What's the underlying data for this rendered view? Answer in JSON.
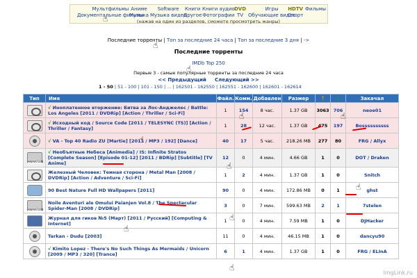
{
  "categories": {
    "col1": [
      "Мультфильмы",
      "Документальные фильмы"
    ],
    "col2": [
      "Аниме",
      "Музыка"
    ],
    "col3": [
      "Software",
      "Музыка видео"
    ],
    "col4": [
      "Книги",
      "Другое"
    ],
    "col5": [
      "Книги аудио",
      "Фотографии"
    ],
    "col6": [
      "DVD",
      "TV"
    ],
    "col7": [
      "Игры",
      "Обучающие видео"
    ],
    "col8": [
      "HDTV",
      "Спорт"
    ],
    "col9": [
      "Фильмы",
      ""
    ],
    "hint": "(нажав на один из разделов, сможете просмотреть жанры)"
  },
  "toplinks": {
    "current": "Последние торренты",
    "link1": "Топ за последние 24 часа",
    "link2": "Топ за последние 3 дня",
    "link3": "->"
  },
  "title": "Последние торренты",
  "imdb": "IMDb Top 250",
  "note": "Первые 3 - самые популярные торренты за последние 24 часа",
  "nav": {
    "prev": "<< Предыдущий",
    "next": "Следующий >>"
  },
  "pages": {
    "current": "1 - 50",
    "items": [
      "51 - 100",
      "101 - 150",
      "...",
      "162501 - 162550",
      "162551 - 162600",
      "162601 - 162614"
    ]
  },
  "table": {
    "headers": [
      "Тип",
      "Имя",
      "Файл.",
      "Комм.",
      "Добавлен",
      "Размер",
      "↑",
      "↓",
      "Закачал"
    ],
    "rows": [
      {
        "kind": "film",
        "check": "√",
        "name": "Иноплатенное вторжение: Битва за Лос-Анджелес / Battle: Los Angeles [2011 / DVDRip] [Action / Thriller / Sci-Fi]",
        "files": "1",
        "comments": "154",
        "added": "8 час.",
        "size": "1.37 GB",
        "seeders": "3063",
        "leechers": "706",
        "uploader": "neoe01"
      },
      {
        "kind": "film",
        "check": "√",
        "name": "Исходный код / Source Code [2011 / TELESYNC (TS)] [Action / Thriller / Fantasy]",
        "files": "1",
        "comments": "28",
        "added": "12 час.",
        "size": "1.37 GB",
        "seeders": "475",
        "leechers": "197",
        "uploader": "Bossssssssss"
      },
      {
        "kind": "music",
        "check": "√",
        "name": "VA - Top 40 Radio ZU [Martie] [2011 / MP3 / 192] [Dance]",
        "files": "40",
        "comments": "17",
        "added": "5 час.",
        "size": "218.26 MB",
        "seeders": "277",
        "leechers": "80",
        "uploader": "FRG / Allyx"
      },
      {
        "kind": "anime",
        "check": "√",
        "name": "Необъятные Небеса [Animedia] / IS: Infinite Stratos [Complete Season] [Episode 01-12] [2011 / BDRip] [Subtitle] [TV Anime]",
        "files": "12",
        "comments": "0",
        "added": "4 мин.",
        "size": "4.66 GB",
        "seeders": "1",
        "leechers": "0",
        "uploader": "DOT / Draken"
      },
      {
        "kind": "film",
        "check": "",
        "name": "Железный Человек: Темная сторона / Metal Man [2008 / DVDRip] [Action / Adventure / Sci-Fi]",
        "files": "1",
        "comments": "2",
        "added": "4 мин.",
        "size": "1.37 GB",
        "seeders": "1",
        "leechers": "0",
        "uploader": "Snitch"
      },
      {
        "kind": "soft",
        "check": "",
        "name": "90 Best Nature Full HD Wallpapers [2011]",
        "files": "90",
        "comments": "0",
        "added": "4 мин.",
        "size": "172.86 MB",
        "seeders": "0",
        "leechers": "1",
        "uploader": "ghst"
      },
      {
        "kind": "anime",
        "check": "",
        "name": "Noile Aventuri ale Omului Paianjen Vol.8 / The Spectacular Spider-Man [2008 / DVDRip]",
        "files": "3",
        "comments": "0",
        "added": "7 мин.",
        "size": "599.63 MB",
        "seeders": "2",
        "leechers": "1",
        "uploader": "7stelen"
      },
      {
        "kind": "book",
        "check": "",
        "name": "Журнал для гиков №5 (Март) [2011 / Русский] [Computing & Internet]",
        "files": "1",
        "comments": "0",
        "added": "4 мин.",
        "size": "7.59 MB",
        "seeders": "1",
        "leechers": "0",
        "uploader": "DJHacker"
      },
      {
        "kind": "music",
        "check": "",
        "name": "Tarkan - Dudu [2003]",
        "files": "11",
        "comments": "0",
        "added": "4 мин.",
        "size": "46.15 MB",
        "seeders": "1",
        "leechers": "0",
        "uploader": "dancyu90"
      },
      {
        "kind": "music",
        "check": "√",
        "name": "Kimito Lopez - There's No Such Things As Mermaids / Unicorn [2009 / MP3 / 320] [Trance]",
        "files": "6",
        "comments": "1",
        "added": "4 мин.",
        "size": "1.37 GB",
        "seeders": "1",
        "leechers": "0",
        "uploader": "FRG / ELInA"
      }
    ]
  },
  "watermark": "ImgLink.ru",
  "icons": [
    "film-reel-icon",
    "music-disc-icon",
    "anime-icon",
    "book-icon",
    "software-icon",
    "hand-cursor-icon",
    "arrow-up-icon",
    "arrow-down-icon"
  ]
}
